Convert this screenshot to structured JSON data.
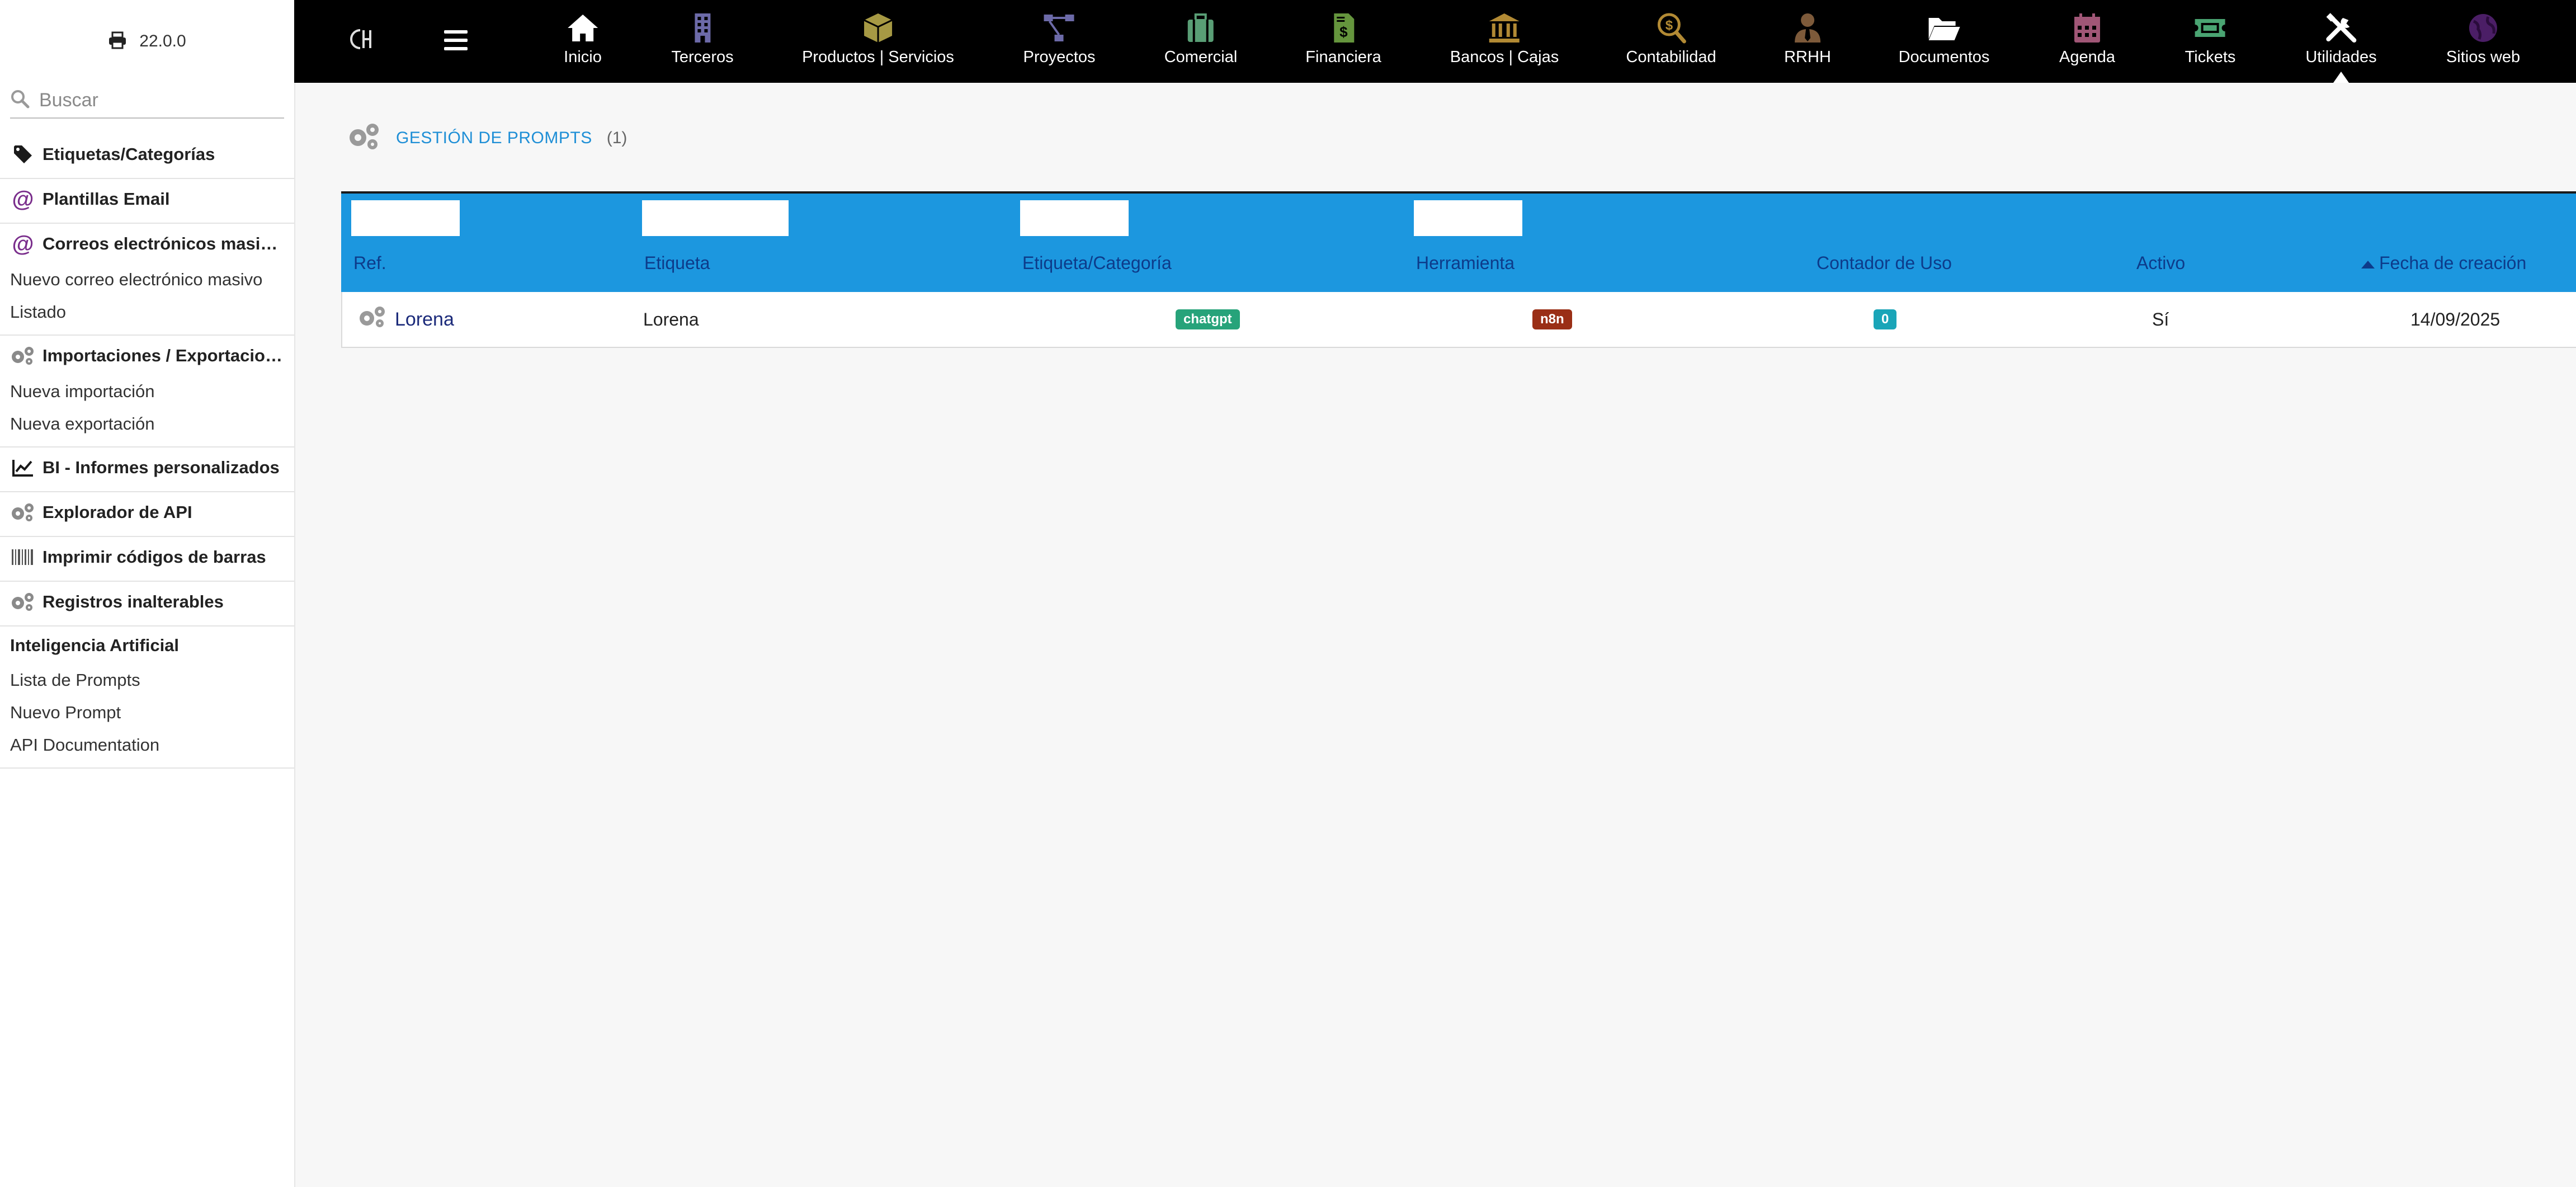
{
  "app": {
    "version": "22.0.0",
    "accent": "#1c97df",
    "topbar_bg": "#000000"
  },
  "sidebar": {
    "search_placeholder": "Buscar",
    "sections": [
      {
        "title": "Etiquetas/Categorías",
        "icon": "tag-icon"
      },
      {
        "title": "Plantillas Email",
        "icon": "at-icon"
      },
      {
        "title": "Correos electrónicos masivos",
        "icon": "at-icon",
        "items": [
          "Nuevo correo electrónico masivo",
          "Listado"
        ]
      },
      {
        "title": "Importaciones / Exportaciones",
        "icon": "gears-icon",
        "items": [
          "Nueva importación",
          "Nueva exportación"
        ]
      },
      {
        "title": "BI - Informes personalizados",
        "icon": "line-chart-icon"
      },
      {
        "title": "Explorador de API",
        "icon": "gears-icon"
      },
      {
        "title": "Imprimir códigos de barras",
        "icon": "barcode-icon"
      },
      {
        "title": "Registros inalterables",
        "icon": "gears-icon"
      },
      {
        "title": "Inteligencia Artificial",
        "icon": "",
        "items": [
          "Lista de Prompts",
          "Nuevo Prompt",
          "API Documentation"
        ]
      }
    ]
  },
  "topnav": {
    "items": [
      {
        "label": "Inicio",
        "icon": "home-icon",
        "color": "#ffffff"
      },
      {
        "label": "Terceros",
        "icon": "building-icon",
        "color": "#6c6aa8"
      },
      {
        "label": "Productos | Servicios",
        "icon": "box-icon",
        "color": "#a69944"
      },
      {
        "label": "Proyectos",
        "icon": "sitemap-icon",
        "color": "#6c6aa8"
      },
      {
        "label": "Comercial",
        "icon": "suitcase-icon",
        "color": "#599e75"
      },
      {
        "label": "Financiera",
        "icon": "invoice-icon",
        "color": "#65953d"
      },
      {
        "label": "Bancos | Cajas",
        "icon": "bank-icon",
        "color": "#b28a34"
      },
      {
        "label": "Contabilidad",
        "icon": "search-dollar-icon",
        "color": "#b28a34"
      },
      {
        "label": "RRHH",
        "icon": "user-tie-icon",
        "color": "#7d5a3a"
      },
      {
        "label": "Documentos",
        "icon": "folder-open-icon",
        "color": "#ffffff"
      },
      {
        "label": "Agenda",
        "icon": "calendar-icon",
        "color": "#a05676"
      },
      {
        "label": "Tickets",
        "icon": "ticket-icon",
        "color": "#4aa472"
      },
      {
        "label": "Utilidades",
        "icon": "tools-icon",
        "color": "#ffffff"
      },
      {
        "label": "Sitios web",
        "icon": "globe-icon",
        "color": "#4b1e66"
      }
    ],
    "active": "Utilidades"
  },
  "page": {
    "title": "GESTIÓN DE PROMPTS",
    "count": "(1)"
  },
  "table": {
    "headers": [
      "Ref.",
      "Etiqueta",
      "Etiqueta/Categoría",
      "Herramienta",
      "Contador de Uso",
      "Activo",
      "Fecha de creación"
    ],
    "sorted_column": "Fecha de creación",
    "rows": [
      {
        "ref": "Lorena",
        "etiqueta": "Lorena",
        "categoria": "chatgpt",
        "categoria_color": "#27a37a",
        "herramienta": "n8n",
        "herramienta_color": "#9a2f16",
        "contador": "0",
        "contador_color": "#1aa5b8",
        "activo": "Sí",
        "fecha": "14/09/2025"
      }
    ]
  }
}
